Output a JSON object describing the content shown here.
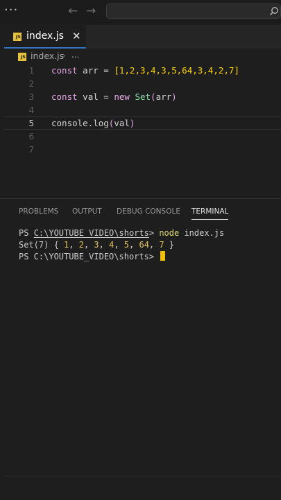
{
  "titlebar": {
    "menu_glyph": "···",
    "back_glyph": "←",
    "forward_glyph": "→",
    "search_placeholder": ""
  },
  "editor": {
    "tab": {
      "label": "index.js",
      "icon_text": "JS",
      "close_glyph": "✕"
    },
    "breadcrumb": {
      "file": "index.js",
      "separator": "›",
      "more": "..."
    },
    "lines": [
      {
        "number": "1"
      },
      {
        "number": "2"
      },
      {
        "number": "3"
      },
      {
        "number": "4"
      },
      {
        "number": "5"
      },
      {
        "number": "6"
      },
      {
        "number": "7"
      }
    ],
    "code": {
      "l1_kw": "const",
      "l1_name": "arr",
      "l1_eq": "=",
      "l1_open": "[",
      "l1_values": "1,2,3,4,3,5,64,3,4,2,7",
      "l1_close": "]",
      "l3_kw": "const",
      "l3_name": "val",
      "l3_eq": "=",
      "l3_new": "new",
      "l3_cls": "Set",
      "l3_open": "(",
      "l3_arg": "arr",
      "l3_close": ")",
      "l5_obj": "console",
      "l5_dot": ".",
      "l5_fn": "log",
      "l5_open": "(",
      "l5_arg": "val",
      "l5_close": ")"
    }
  },
  "panel": {
    "tabs": [
      {
        "label": "PROBLEMS"
      },
      {
        "label": "OUTPUT"
      },
      {
        "label": "DEBUG CONSOLE"
      },
      {
        "label": "TERMINAL"
      }
    ],
    "active_tab": "TERMINAL",
    "terminal": {
      "prompt1_prefix": "PS ",
      "prompt1_path": "C:\\YOUTUBE_VIDEO\\shorts",
      "prompt1_suffix": "> ",
      "cmd_program": "node",
      "cmd_arg": " index.js",
      "out_prefix": "Set(7) { ",
      "out_values": [
        "1",
        "2",
        "3",
        "4",
        "5",
        "64",
        "7"
      ],
      "out_suffix": " }",
      "prompt2": "PS C:\\YOUTUBE_VIDEO\\shorts> "
    }
  },
  "colors": {
    "background": "#1e1e1e",
    "keyword": "#e4a8e4",
    "number": "#ffd200",
    "class": "#8be0a6",
    "accent_tab": "#2f6fbe",
    "cursor": "#f0c000"
  }
}
